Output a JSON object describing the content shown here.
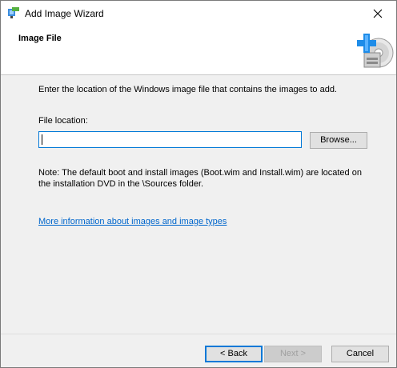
{
  "window": {
    "title": "Add Image Wizard"
  },
  "icons": {
    "app": "wizard-app-icon",
    "close": "close-icon",
    "header": "add-image-disc-icon"
  },
  "header": {
    "page_title": "Image File"
  },
  "content": {
    "instructions": "Enter the location of the Windows image file that contains the images to add.",
    "file_location_label": "File location:",
    "file_location_value": "",
    "browse_label": "Browse...",
    "note": "Note: The default boot and install images (Boot.wim and Install.wim) are located on the installation DVD in the \\Sources folder.",
    "more_info_link": "More information about images and image types"
  },
  "footer": {
    "back_label": "< Back",
    "next_label": "Next >",
    "cancel_label": "Cancel"
  },
  "colors": {
    "accent": "#0078d7",
    "link": "#0066cc",
    "dialog_bg": "#f0f0f0"
  }
}
